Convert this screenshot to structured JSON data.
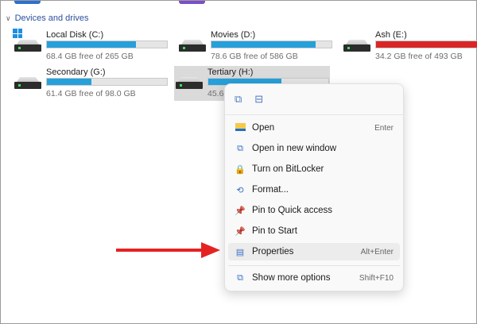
{
  "section": {
    "label": "Devices and drives"
  },
  "drives": [
    {
      "name": "Local Disk (C:)",
      "free": "68.4 GB free of 265 GB",
      "used_pct": 74,
      "color": "#26a0da"
    },
    {
      "name": "Movies (D:)",
      "free": "78.6 GB free of 586 GB",
      "used_pct": 87,
      "color": "#26a0da"
    },
    {
      "name": "Ash (E:)",
      "free": "34.2 GB free of 493 GB",
      "used_pct": 93,
      "color": "#da2626"
    },
    {
      "name": "Secondary (G:)",
      "free": "61.4 GB free of 98.0 GB",
      "used_pct": 37,
      "color": "#26a0da"
    },
    {
      "name": "Tertiary (H:)",
      "free": "45.6",
      "used_pct": 61,
      "color": "#26a0da"
    }
  ],
  "menu": {
    "quick_icons": [
      "copy-icon",
      "rename-icon"
    ],
    "items": [
      {
        "label": "Open",
        "shortcut": "Enter",
        "icon": "folder-icon"
      },
      {
        "label": "Open in new window",
        "shortcut": "",
        "icon": "open-new-window-icon"
      },
      {
        "label": "Turn on BitLocker",
        "shortcut": "",
        "icon": "bitlocker-icon"
      },
      {
        "label": "Format...",
        "shortcut": "",
        "icon": "format-icon"
      },
      {
        "label": "Pin to Quick access",
        "shortcut": "",
        "icon": "pin-icon"
      },
      {
        "label": "Pin to Start",
        "shortcut": "",
        "icon": "pin-icon"
      },
      {
        "label": "Properties",
        "shortcut": "Alt+Enter",
        "icon": "properties-icon"
      },
      {
        "label": "Show more options",
        "shortcut": "Shift+F10",
        "icon": "show-more-icon"
      }
    ]
  }
}
